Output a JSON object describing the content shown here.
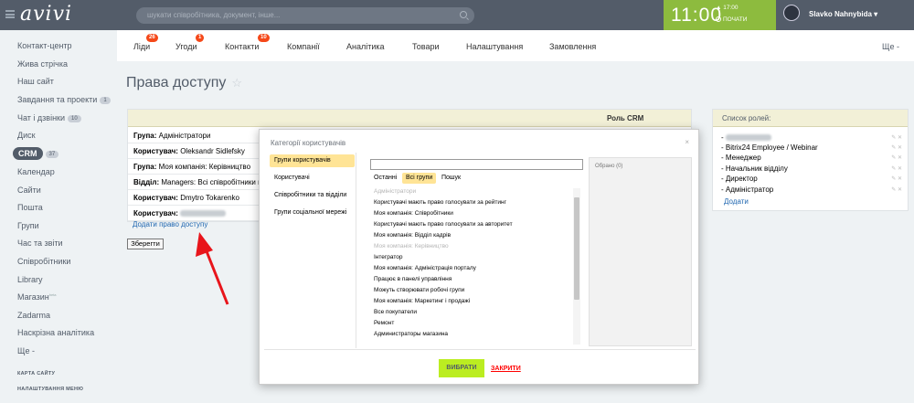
{
  "header": {
    "logo": "avivi",
    "search_placeholder": "шукати співробітника, документ, інше...",
    "clock_time": "11:00",
    "clock_small": "▲ 17:00",
    "clock_start": "ПОЧАТИ",
    "user_name": "Slavko Nahnybida ▾"
  },
  "sidebar": {
    "items": [
      {
        "label": "Контакт-центр"
      },
      {
        "label": "Жива стрічка"
      },
      {
        "label": "Наш сайт"
      },
      {
        "label": "Завдання та проекти",
        "count": "1"
      },
      {
        "label": "Чат і дзвінки",
        "count": "10"
      },
      {
        "label": "Диск"
      },
      {
        "label": "CRM",
        "count": "37"
      },
      {
        "label": "Календар"
      },
      {
        "label": "Сайти"
      },
      {
        "label": "Пошта"
      },
      {
        "label": "Групи"
      },
      {
        "label": "Час та звіти"
      },
      {
        "label": "Співробітники"
      },
      {
        "label": "Library"
      },
      {
        "label": "Магазин",
        "sup": "beta"
      },
      {
        "label": "Zadarma"
      },
      {
        "label": "Наскрізна аналітика"
      },
      {
        "label": "Ще -"
      }
    ],
    "sitemap": "КАРТА САЙТУ",
    "menu_settings": "НАЛАШТУВАННЯ МЕНЮ"
  },
  "nav": {
    "tabs": [
      {
        "label": "Ліди",
        "badge": "26"
      },
      {
        "label": "Угоди",
        "badge": "1"
      },
      {
        "label": "Контакти",
        "badge": "10"
      },
      {
        "label": "Компанії"
      },
      {
        "label": "Аналітика"
      },
      {
        "label": "Товари"
      },
      {
        "label": "Налаштування"
      },
      {
        "label": "Замовлення"
      }
    ],
    "more": "Ще -"
  },
  "page": {
    "title": "Права доступу",
    "star": "☆"
  },
  "permissions": {
    "column_header": "Роль CRM",
    "rows": [
      {
        "prefix": "Група:",
        "name": "Адміністратори"
      },
      {
        "prefix": "Користувач:",
        "name": "Oleksandr Sidlefsky"
      },
      {
        "prefix": "Група:",
        "name": "Моя компанія: Керівництво"
      },
      {
        "prefix": "Відділ:",
        "name": "Managers: Всі співробітники від"
      },
      {
        "prefix": "Користувач:",
        "name": "Dmytro Tokarenko"
      },
      {
        "prefix": "Користувач:",
        "name": ""
      }
    ],
    "add_link": "Додати право доступу",
    "save_button": "Зберегти"
  },
  "roles": {
    "title": "Список ролей:",
    "items": [
      {
        "name": ""
      },
      {
        "name": "Bitrix24 Employee / Webinar"
      },
      {
        "name": "Менеджер"
      },
      {
        "name": "Начальник відділу"
      },
      {
        "name": "Директор"
      },
      {
        "name": "Адміністратор"
      }
    ],
    "add": "Додати",
    "tools": "✎ ✕"
  },
  "dialog": {
    "title": "Категорії користувачів",
    "close": "×",
    "categories": [
      "Групи користувачів",
      "Користувачі",
      "Співробітники та відділи",
      "Групи соціальної мережі"
    ],
    "subtabs": [
      "Останні",
      "Всі групи",
      "Пошук"
    ],
    "list": [
      {
        "label": "Адміністратори",
        "dim": true
      },
      {
        "label": "Користувачі мають право голосувати за рейтинг"
      },
      {
        "label": "Моя компанія: Співробітники"
      },
      {
        "label": "Користувачі мають право голосувати за авторитет"
      },
      {
        "label": "Моя компанія: Відділ кадрів"
      },
      {
        "label": "Моя компанія: Керівництво",
        "dim": true
      },
      {
        "label": "Інтегратор"
      },
      {
        "label": "Моя компанія: Адміністрація порталу"
      },
      {
        "label": "Працює в панелі управління"
      },
      {
        "label": "Можуть створювати робочі групи"
      },
      {
        "label": "Моя компанія: Маркетинг і продажі"
      },
      {
        "label": "Все покупатели"
      },
      {
        "label": "Ремонт"
      },
      {
        "label": "Администраторы магазина"
      }
    ],
    "selected_label": "Обрано (0)",
    "select_button": "ВИБРАТИ",
    "close_button": "ЗАКРИТИ"
  },
  "colors": {
    "topbar": "#535c69",
    "clock": "#8dbb3e",
    "badge": "#f54819",
    "highlight": "#ffe496",
    "select_button": "#bbed21",
    "arrow": "#e8151b"
  }
}
